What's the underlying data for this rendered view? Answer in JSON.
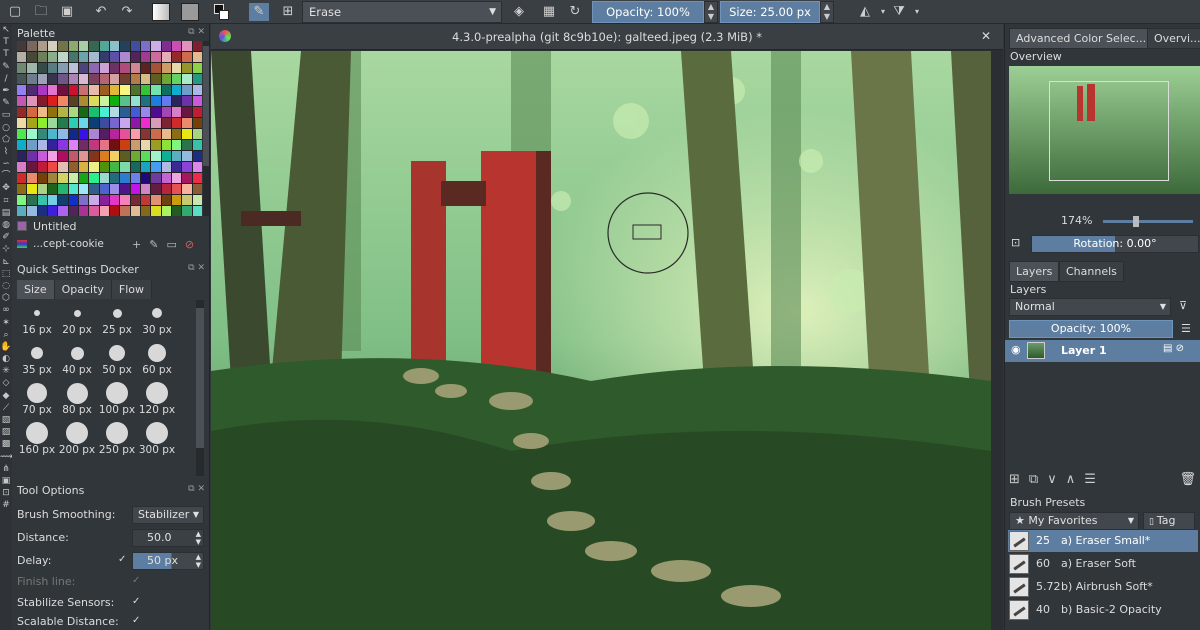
{
  "toolbar": {
    "blending_mode": "Erase",
    "opacity": "Opacity: 100%",
    "size": "Size: 25.00 px"
  },
  "document": {
    "title": "4.3.0-prealpha (git 8c9b10e): galteed.jpeg (2.3 MiB) *"
  },
  "palette": {
    "title": "Palette",
    "name": "Untitled",
    "set_name": "...cept-cookie"
  },
  "quick_settings": {
    "title": "Quick Settings Docker",
    "tabs": [
      "Size",
      "Opacity",
      "Flow"
    ],
    "sizes": [
      "16 px",
      "20 px",
      "25 px",
      "30 px",
      "35 px",
      "40 px",
      "50 px",
      "60 px",
      "70 px",
      "80 px",
      "100 px",
      "120 px",
      "160 px",
      "200 px",
      "250 px",
      "300 px"
    ]
  },
  "tool_options": {
    "title": "Tool Options",
    "brush_smoothing_label": "Brush Smoothing:",
    "brush_smoothing_value": "Stabilizer",
    "distance_label": "Distance:",
    "distance_value": "50.0",
    "delay_label": "Delay:",
    "delay_value": "50 px",
    "finish_line_label": "Finish line:",
    "stabilize_sensors_label": "Stabilize Sensors:",
    "scalable_distance_label": "Scalable Distance:"
  },
  "right": {
    "top_tabs": [
      "Advanced Color Selec...",
      "Overvi..."
    ],
    "overview_title": "Overview",
    "zoom": "174%",
    "rotation": "Rotation: 0.00°",
    "layer_tabs": [
      "Layers",
      "Channels"
    ],
    "layers_title": "Layers",
    "blend_mode": "Normal",
    "layer_opacity": "Opacity:  100%",
    "layer_name": "Layer 1",
    "brush_presets_title": "Brush Presets",
    "favorites": "★ My Favorites",
    "tag": "Tag",
    "presets": [
      {
        "size": "25",
        "name": "a) Eraser Small*"
      },
      {
        "size": "60",
        "name": "a) Eraser Soft"
      },
      {
        "size": "5.72",
        "name": "b) Airbrush Soft*"
      },
      {
        "size": "40",
        "name": "b) Basic-2 Opacity"
      }
    ]
  },
  "colors": {
    "accent": "#5d7ea0",
    "panel": "#31363b"
  }
}
